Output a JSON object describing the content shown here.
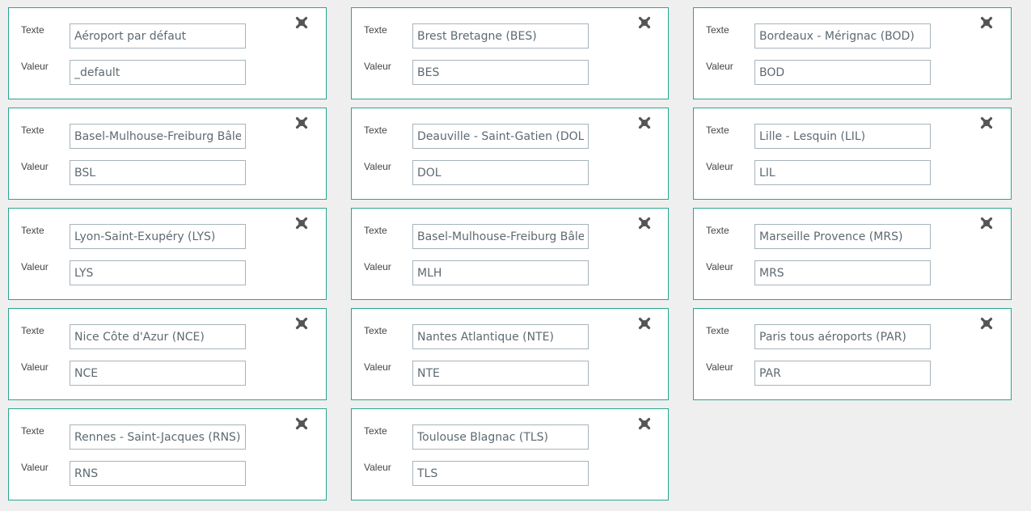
{
  "labels": {
    "text": "Texte",
    "value": "Valeur"
  },
  "colors": {
    "card_border": "#2aa58e",
    "close_icon": "#555555",
    "background": "#efefef"
  },
  "icons": {
    "remove": "close-icon"
  },
  "entries": [
    {
      "text": "Aéroport par défaut",
      "value": "_default"
    },
    {
      "text": "Brest Bretagne (BES)",
      "value": "BES"
    },
    {
      "text": "Bordeaux - Mérignac (BOD)",
      "value": "BOD"
    },
    {
      "text": "Basel-Mulhouse-Freiburg Bâle",
      "value": "BSL"
    },
    {
      "text": "Deauville - Saint-Gatien (DOL)",
      "value": "DOL"
    },
    {
      "text": "Lille - Lesquin (LIL)",
      "value": "LIL"
    },
    {
      "text": "Lyon-Saint-Exupéry (LYS)",
      "value": "LYS"
    },
    {
      "text": "Basel-Mulhouse-Freiburg Bâle",
      "value": "MLH"
    },
    {
      "text": "Marseille Provence (MRS)",
      "value": "MRS"
    },
    {
      "text": "Nice Côte d'Azur (NCE)",
      "value": "NCE"
    },
    {
      "text": "Nantes Atlantique (NTE)",
      "value": "NTE"
    },
    {
      "text": "Paris tous aéroports (PAR)",
      "value": "PAR"
    },
    {
      "text": "Rennes - Saint-Jacques (RNS)",
      "value": "RNS"
    },
    {
      "text": "Toulouse Blagnac (TLS)",
      "value": "TLS"
    }
  ]
}
